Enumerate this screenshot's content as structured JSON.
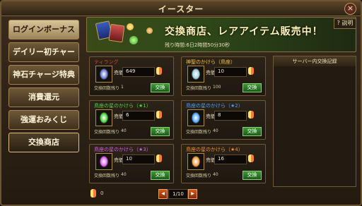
{
  "window": {
    "title": "イースター",
    "close_label": "×"
  },
  "sidebar": {
    "items": [
      {
        "label": "ログインボーナス",
        "state": "active"
      },
      {
        "label": "デイリー初チャージ",
        "state": "normal"
      },
      {
        "label": "神石チャージ特典",
        "state": "normal"
      },
      {
        "label": "消費還元",
        "state": "normal"
      },
      {
        "label": "強運おみくじ",
        "state": "normal"
      },
      {
        "label": "交換商店",
        "state": "selected"
      }
    ]
  },
  "banner": {
    "title": "交換商店、レアアイテム販売中！",
    "period": "残り時間:6日2時間50分30秒",
    "help_label": "? 説明"
  },
  "items": [
    {
      "name": "ティラング",
      "name_color": "#e04030",
      "price_label": "売価",
      "price": "649",
      "remaining_label": "交換回数残り",
      "remaining": "1",
      "button": "交換",
      "icon": "book-icon",
      "glow": "#6a7ad0"
    },
    {
      "name": "神聖のかけら（鳥座）",
      "name_color": "#f0c040",
      "price_label": "売価",
      "price": "10",
      "remaining_label": "交換回数残り",
      "remaining": "100",
      "button": "交換",
      "icon": "holy-shard-icon",
      "glow": "#9fd0e0"
    },
    {
      "name": "鳥座の星のかけら（★1）",
      "name_color": "#5ad04a",
      "price_label": "売価",
      "price": "6",
      "remaining_label": "交換回数残り",
      "remaining": "40",
      "button": "交換",
      "icon": "green-star-shard-icon",
      "glow": "#4ad040"
    },
    {
      "name": "鳥座の星のかけら（★2）",
      "name_color": "#4aa0f0",
      "price_label": "売価",
      "price": "8",
      "remaining_label": "交換回数残り",
      "remaining": "40",
      "button": "交換",
      "icon": "blue-star-shard-icon",
      "glow": "#50a8ff"
    },
    {
      "name": "鳥座の星のかけら（★3）",
      "name_color": "#d060e0",
      "price_label": "売価",
      "price": "10",
      "remaining_label": "交換回数残り",
      "remaining": "40",
      "button": "交換",
      "icon": "purple-star-shard-icon",
      "glow": "#e060f0"
    },
    {
      "name": "鳥座の星のかけら（★4）",
      "name_color": "#f09030",
      "price_label": "売価",
      "price": "16",
      "remaining_label": "交換回数残り",
      "remaining": "40",
      "button": "交換",
      "icon": "orange-star-shard-icon",
      "glow": "#f0a040"
    }
  ],
  "records": {
    "title": "サーバー内交換記録"
  },
  "footer": {
    "owned": "0",
    "page": "1/10",
    "prev_label": "◀",
    "next_label": "▶"
  }
}
